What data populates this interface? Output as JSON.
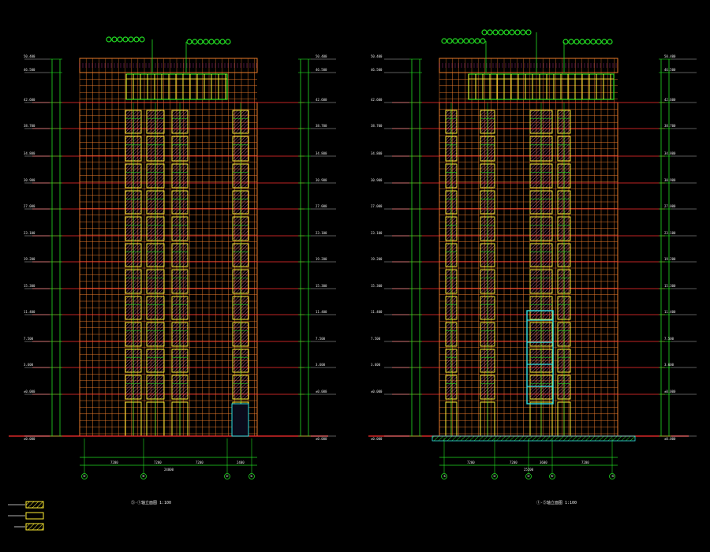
{
  "app": {
    "type": "CAD architectural elevation drawing",
    "background": "#000000"
  },
  "colors": {
    "grid": "#e87a2a",
    "floor_line": "#ff3030",
    "green": "#22dd22",
    "yellow": "#ffee33",
    "cyan": "#33e0e0",
    "white": "#e8e8e8",
    "magenta": "#ff44cc"
  },
  "elevations": {
    "left": {
      "title": "⑤-①轴立面图 1:100",
      "axis_labels": [
        "⑤",
        "④",
        "②",
        "①"
      ],
      "dims_bottom": [
        "7200",
        "7200",
        "7200",
        "2400"
      ],
      "dims_total": "24000"
    },
    "right": {
      "title": "①-⑤轴立面图 1:100",
      "axis_labels": [
        "①",
        "②",
        "③",
        "④",
        "⑤"
      ],
      "dims_bottom": [
        "7200",
        "7200",
        "3600",
        "7200"
      ],
      "dims_total": "25200"
    }
  },
  "levels": [
    "±0.000",
    "3.600",
    "7.500",
    "11.400",
    "15.300",
    "19.200",
    "23.100",
    "27.000",
    "30.900",
    "34.800",
    "38.700",
    "42.600",
    "46.500",
    "50.400"
  ],
  "legend": [
    {
      "name": "legend-hatch-1",
      "label": ""
    },
    {
      "name": "legend-hatch-2",
      "label": ""
    },
    {
      "name": "legend-hatch-3",
      "label": ""
    }
  ]
}
